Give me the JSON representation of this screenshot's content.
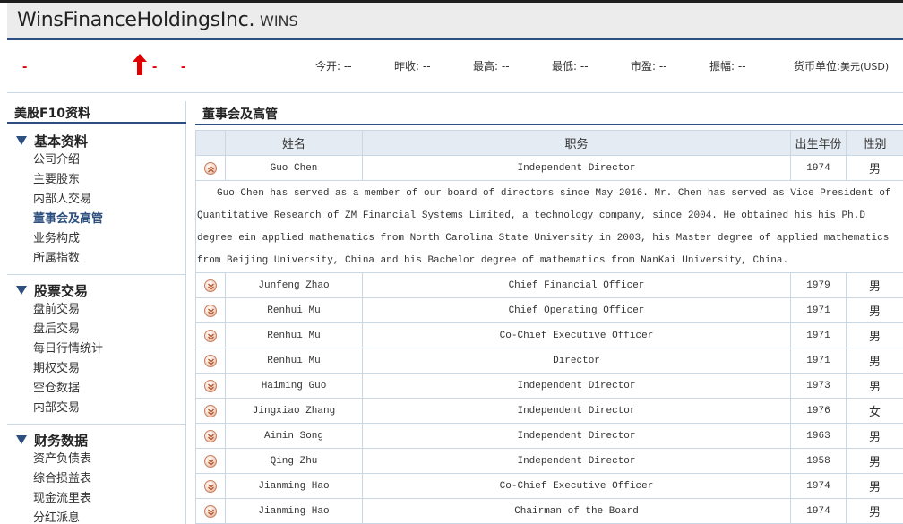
{
  "header": {
    "company": "WinsFinanceHoldingsInc.",
    "ticker": "WINS"
  },
  "quote": {
    "price": "-",
    "change": "-",
    "change_pct": "-",
    "arrow_color": "#e00000",
    "items": [
      {
        "label": "今开:",
        "value": "--"
      },
      {
        "label": "昨收:",
        "value": "--"
      },
      {
        "label": "最高:",
        "value": "--"
      },
      {
        "label": "最低:",
        "value": "--"
      },
      {
        "label": "市盈:",
        "value": "--"
      },
      {
        "label": "振幅:",
        "value": "--"
      },
      {
        "label": "货币单位:",
        "value": "美元(USD)"
      }
    ]
  },
  "sidebar": {
    "title": "美股F10资料",
    "groups": [
      {
        "name": "基本资料",
        "items": [
          "公司介绍",
          "主要股东",
          "内部人交易",
          "董事会及高管",
          "业务构成",
          "所属指数"
        ],
        "active": "董事会及高管"
      },
      {
        "name": "股票交易",
        "items": [
          "盘前交易",
          "盘后交易",
          "每日行情统计",
          "期权交易",
          "空仓数据",
          "内部交易"
        ]
      },
      {
        "name": "财务数据",
        "items": [
          "资产负债表",
          "综合损益表",
          "现金流里表",
          "分红派息"
        ]
      }
    ]
  },
  "main": {
    "title": "董事会及高管",
    "columns": [
      "",
      "姓名",
      "职务",
      "出生年份",
      "性别"
    ],
    "expanded_bio": "Guo Chen has served as a member of our board of directors since May 2016. Mr. Chen has served as Vice President of Quantitative Research of ZM Financial Systems Limited, a technology company, since 2004. He obtained his his Ph.D degree ein applied mathematics from North Carolina State University in 2003, his Master degree of applied mathematics from Beijing University, China and his Bachelor degree of mathematics from NanKai University, China.",
    "rows": [
      {
        "name": "Guo Chen",
        "title": "Independent Director",
        "year": "1974",
        "sex": "男",
        "expanded": true
      },
      {
        "name": "Junfeng Zhao",
        "title": "Chief Financial Officer",
        "year": "1979",
        "sex": "男"
      },
      {
        "name": "Renhui Mu",
        "title": "Chief Operating Officer",
        "year": "1971",
        "sex": "男"
      },
      {
        "name": "Renhui Mu",
        "title": "Co-Chief Executive Officer",
        "year": "1971",
        "sex": "男"
      },
      {
        "name": "Renhui Mu",
        "title": "Director",
        "year": "1971",
        "sex": "男"
      },
      {
        "name": "Haiming Guo",
        "title": "Independent Director",
        "year": "1973",
        "sex": "男"
      },
      {
        "name": "Jingxiao Zhang",
        "title": "Independent Director",
        "year": "1976",
        "sex": "女"
      },
      {
        "name": "Aimin Song",
        "title": "Independent Director",
        "year": "1963",
        "sex": "男"
      },
      {
        "name": "Qing Zhu",
        "title": "Independent Director",
        "year": "1958",
        "sex": "男"
      },
      {
        "name": "Jianming Hao",
        "title": "Co-Chief Executive Officer",
        "year": "1974",
        "sex": "男"
      },
      {
        "name": "Jianming Hao",
        "title": "Chairman of the Board",
        "year": "1974",
        "sex": "男"
      }
    ]
  }
}
